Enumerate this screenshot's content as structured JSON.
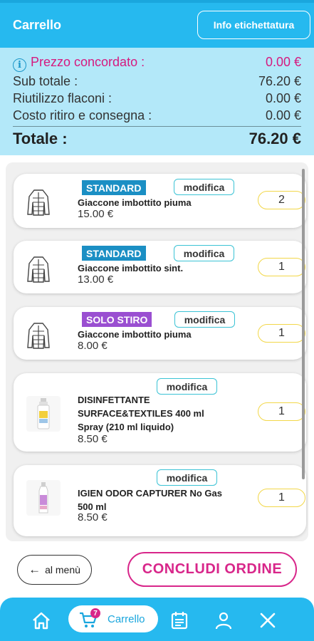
{
  "header": {
    "title": "Carrello",
    "info_button": "Info etichettatura"
  },
  "summary": {
    "prezzo_concordato": {
      "label": "Prezzo concordato :",
      "value": "0.00 €"
    },
    "sub_totale": {
      "label": "Sub totale :",
      "value": "76.20 €"
    },
    "riutilizzo": {
      "label": "Riutilizzo flaconi :",
      "value": "0.00 €"
    },
    "costo_ritiro": {
      "label": "Costo ritiro e consegna :",
      "value": "0.00 €"
    },
    "totale": {
      "label": "Totale :",
      "value": "76.20 €"
    }
  },
  "items": [
    {
      "badge": "STANDARD",
      "badge_color": "#1b8fc4",
      "modify": "modifica",
      "name": "Giaccone imbottito piuma",
      "price": "15.00 €",
      "qty": "2",
      "icon": "jacket-icon"
    },
    {
      "badge": "STANDARD",
      "badge_color": "#1b8fc4",
      "modify": "modifica",
      "name": "Giaccone imbottito sint.",
      "price": "13.00 €",
      "qty": "1",
      "icon": "jacket-icon"
    },
    {
      "badge": "SOLO STIRO",
      "badge_color": "#9a4fd1",
      "modify": "modifica",
      "name": "Giaccone imbottito piuma",
      "price": "8.00 €",
      "qty": "1",
      "icon": "jacket-icon"
    },
    {
      "modify": "modifica",
      "name_lines": [
        "DISINFETTANTE",
        "SURFACE&TEXTILES 400 ml",
        "Spray (210 ml liquido)"
      ],
      "price": "8.50 €",
      "qty": "1",
      "icon": "spray-bottle-icon"
    },
    {
      "modify": "modifica",
      "name_lines": [
        "IGIEN ODOR CAPTURER No Gas",
        "500 ml"
      ],
      "price": "8.50 €",
      "qty": "1",
      "icon": "bottle-icon"
    }
  ],
  "actions": {
    "back_label": "al menù",
    "conclude_label": "CONCLUDI ORDINE"
  },
  "nav": {
    "cart_label": "Carrello",
    "cart_count": "7"
  },
  "colors": {
    "primary": "#26b9ef",
    "summary_bg": "#b3e8f9",
    "accent": "#d8268a",
    "qty_border": "#f2d749"
  }
}
